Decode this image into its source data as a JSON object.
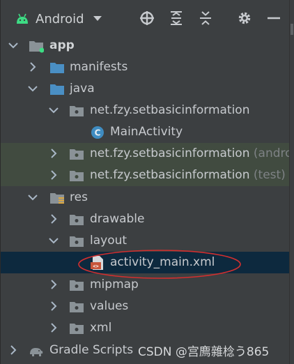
{
  "toolbar": {
    "view_selector": "Android",
    "icons": [
      "android-icon",
      "chevron-down-icon",
      "locate-icon",
      "expand-all-icon",
      "collapse-all-icon",
      "gear-icon",
      "minimize-icon"
    ]
  },
  "tree": [
    {
      "label": "app",
      "icon": "module-folder-icon",
      "expanded": true
    },
    {
      "label": "manifests",
      "icon": "folder-icon",
      "expanded": false
    },
    {
      "label": "java",
      "icon": "folder-icon",
      "expanded": true
    },
    {
      "label": "net.fzy.setbasicinformation",
      "icon": "package-icon",
      "expanded": true
    },
    {
      "label": "MainActivity",
      "icon": "class-icon"
    },
    {
      "label": "net.fzy.setbasicinformation",
      "suffix": "(androidTest)",
      "icon": "package-icon",
      "expanded": false
    },
    {
      "label": "net.fzy.setbasicinformation",
      "suffix": "(test)",
      "icon": "package-icon",
      "expanded": false
    },
    {
      "label": "res",
      "icon": "resources-folder-icon",
      "expanded": true
    },
    {
      "label": "drawable",
      "icon": "package-icon",
      "expanded": false
    },
    {
      "label": "layout",
      "icon": "package-icon",
      "expanded": true
    },
    {
      "label": "activity_main.xml",
      "icon": "xml-layout-file-icon",
      "selected": true
    },
    {
      "label": "mipmap",
      "icon": "package-icon",
      "expanded": false
    },
    {
      "label": "values",
      "icon": "package-icon",
      "expanded": false
    },
    {
      "label": "xml",
      "icon": "package-icon",
      "expanded": false
    },
    {
      "label": "Gradle Scripts",
      "icon": "gradle-elephant-icon",
      "expanded": false
    }
  ],
  "watermark": "CSDN @宫廌雜棯う865",
  "colors": {
    "panel_bg": "#3c3f41",
    "selected_row": "#0d293e",
    "test_row": "#414b40",
    "annotation_ellipse": "#d32f2f",
    "android_green": "#3ddc84"
  }
}
